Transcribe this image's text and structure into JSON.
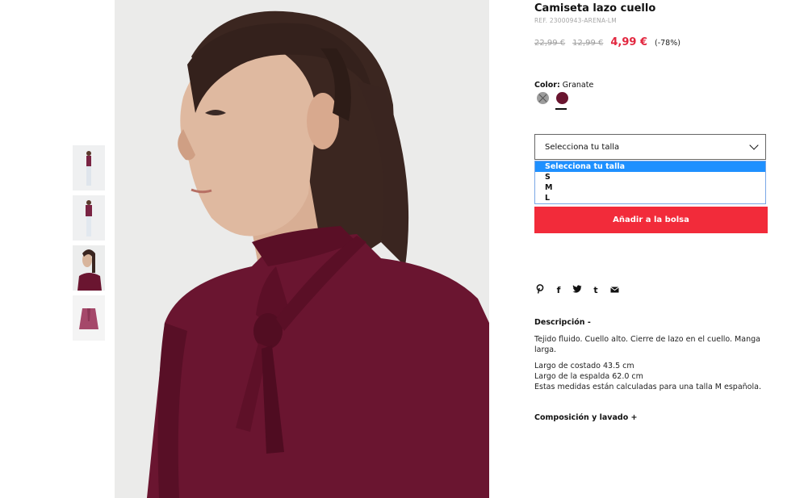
{
  "product": {
    "title": "Camiseta lazo cuello",
    "ref": "REF. 23000943-ARENA-LM",
    "prices": {
      "original": "22,99 €",
      "previous": "12,99 €",
      "sale": "4,99 €",
      "discount": "(-78%)"
    },
    "color_label": "Color:",
    "color_value": "Granate",
    "swatches": [
      {
        "name": "gris",
        "color": "#9c9c9c",
        "available": false
      },
      {
        "name": "granate",
        "color": "#6a1530",
        "selected": true
      }
    ],
    "size_select": {
      "placeholder": "Selecciona tu talla",
      "options": [
        "Selecciona tu talla",
        "S",
        "M",
        "L"
      ],
      "highlighted": "Selecciona tu talla"
    },
    "add_to_bag": "Añadir a la bolsa",
    "share_icons": [
      "pinterest-icon",
      "facebook-icon",
      "twitter-icon",
      "tumblr-icon",
      "email-icon"
    ],
    "share_glyphs": {
      "pinterest": "℗",
      "facebook": "f",
      "twitter": "🐦",
      "tumblr": "t",
      "email": "✉"
    },
    "description": {
      "heading": "Descripción -",
      "text": "Tejido fluido. Cuello alto. Cierre de lazo en el cuello. Manga larga.",
      "measure_1": "Largo de costado 43.5 cm",
      "measure_2": "Largo de la espalda 62.0 cm",
      "measure_note": "Estas medidas están calculadas para una talla M española."
    },
    "composition_heading": "Composición y lavado +"
  },
  "colors": {
    "accent_red": "#f22b3a",
    "sale_price": "#e2273f",
    "garment": "#6a1530",
    "dropdown_highlight": "#1e90ff"
  }
}
